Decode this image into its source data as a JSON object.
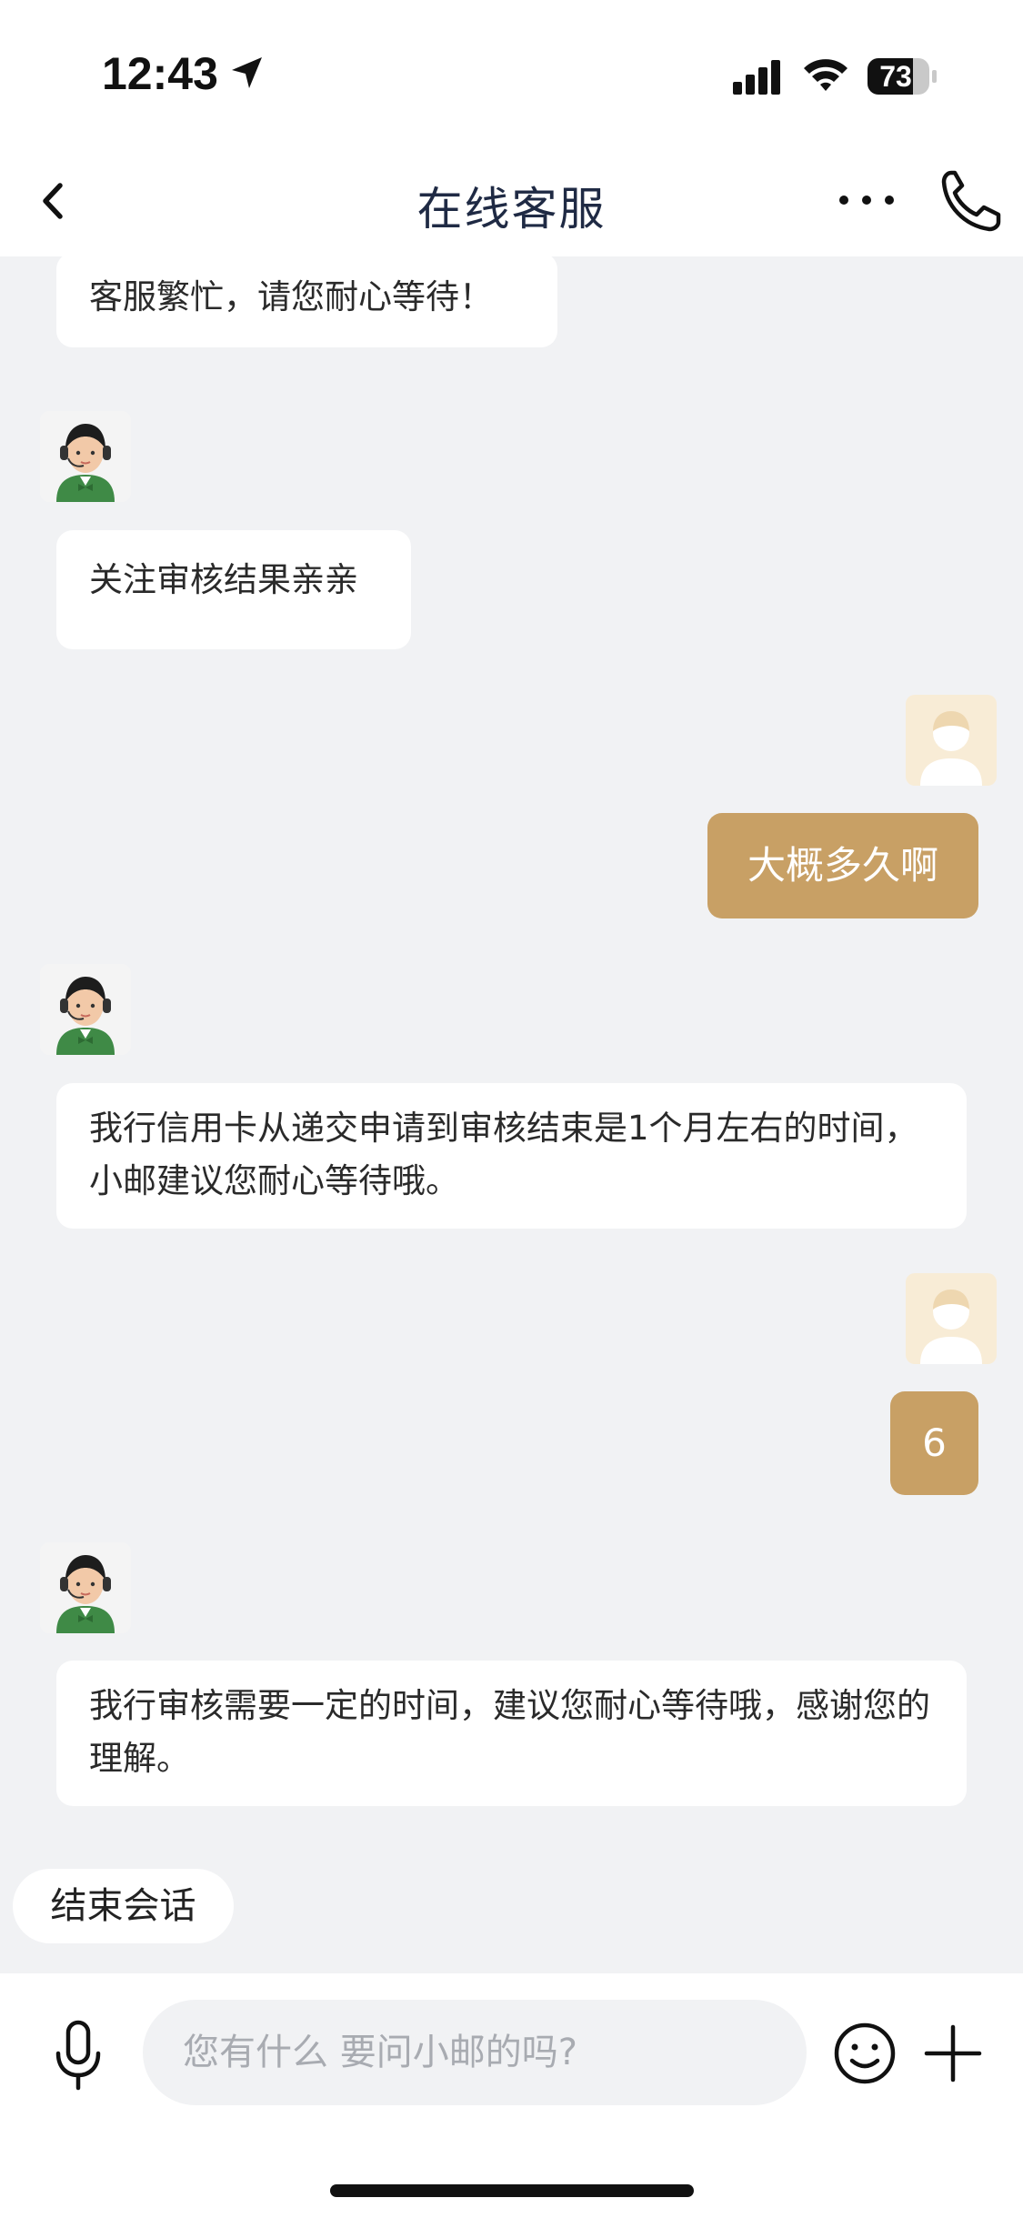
{
  "status_bar": {
    "time": "12:43",
    "battery": "73",
    "icons": [
      "location-arrow-icon",
      "signal-icon",
      "wifi-icon",
      "battery-icon"
    ]
  },
  "nav": {
    "title": "在线客服",
    "icons": [
      "back-icon",
      "more-icon",
      "phone-icon"
    ]
  },
  "messages": [
    {
      "sender": "agent",
      "text": "客服繁忙，请您耐心等待！"
    },
    {
      "sender": "agent",
      "text": "关注审核结果亲亲"
    },
    {
      "sender": "user",
      "text": "大概多久啊"
    },
    {
      "sender": "agent",
      "text": "我行信用卡从递交申请到审核结束是1个月左右的时间，小邮建议您耐心等待哦。"
    },
    {
      "sender": "user",
      "text": "6"
    },
    {
      "sender": "agent",
      "text": "我行审核需要一定的时间，建议您耐心等待哦，感谢您的理解。"
    }
  ],
  "end_session_label": "结束会话",
  "input": {
    "placeholder": "您有什么 要问小邮的吗?",
    "value": ""
  },
  "colors": {
    "accent": "#c8a065",
    "chat_bg": "#f1f2f4",
    "title": "#1f2a44"
  }
}
